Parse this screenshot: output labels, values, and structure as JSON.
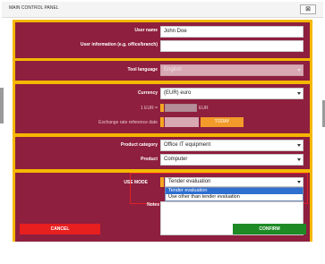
{
  "window": {
    "title": "MAIN CONTROL PANEL",
    "close_glyph": "⊠"
  },
  "form": {
    "user_name": {
      "label": "User name",
      "value": "John Doe"
    },
    "user_info": {
      "label": "User information (e.g. office/branch)",
      "value": ""
    },
    "tool_language": {
      "label": "Tool language",
      "value": "English"
    },
    "currency": {
      "label": "Currency",
      "value": "(EUR) euro"
    },
    "exchange": {
      "label": "1 EUR =",
      "unit": "EUR"
    },
    "ref_date": {
      "label": "Exchange rate reference date",
      "value": "",
      "today_label": "TODAY"
    },
    "product_category": {
      "label": "Product category",
      "value": "Office IT equipment"
    },
    "product": {
      "label": "Product",
      "value": "Computer"
    },
    "use_mode": {
      "label": "USE MODE",
      "value": "Tender evaluation",
      "options": [
        "Tender evaluation",
        "Use other than tender evaluation"
      ],
      "selected_index": 0
    },
    "notes": {
      "label": "Notes",
      "value": ""
    }
  },
  "buttons": {
    "cancel": "CANCEL",
    "confirm": "CONFIRM"
  },
  "colors": {
    "panel": "#8e1f3e",
    "frame": "#f5b800",
    "cancel": "#e81f1f",
    "confirm": "#1e8a25",
    "highlight": "#e0202a"
  }
}
